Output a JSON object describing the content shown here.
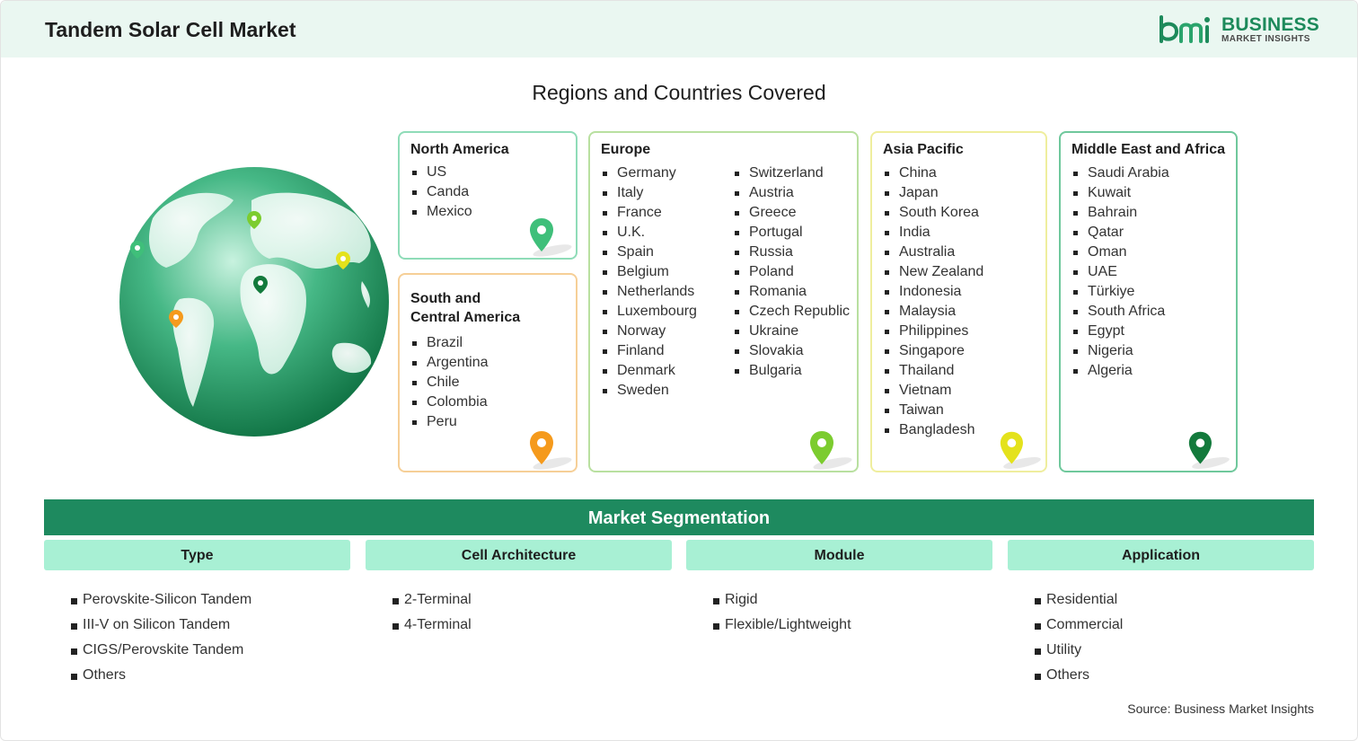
{
  "header": {
    "title": "Tandem Solar Cell Market"
  },
  "logo": {
    "mark": "bmi",
    "word1": "BUSINESS",
    "word2": "MARKET INSIGHTS"
  },
  "regions": {
    "title": "Regions and Countries Covered",
    "north_america": {
      "title": "North America",
      "countries": [
        "US",
        "Canda",
        "Mexico"
      ],
      "pin_color": "#3fbf7a"
    },
    "south_central_america": {
      "title_line1": "South and",
      "title_line2": "Central America",
      "countries": [
        "Brazil",
        "Argentina",
        "Chile",
        "Colombia",
        "Peru"
      ],
      "pin_color": "#f59a1c"
    },
    "europe": {
      "title": "Europe",
      "countries_col1": [
        "Germany",
        "Italy",
        "France",
        "U.K.",
        "Spain",
        "Belgium",
        "Netherlands",
        "Luxembourg",
        "Norway",
        "Finland",
        "Denmark",
        "Sweden"
      ],
      "countries_col2": [
        "Switzerland",
        "Austria",
        "Greece",
        "Portugal",
        "Russia",
        "Poland",
        "Romania",
        "Czech Republic",
        "Ukraine",
        "Slovakia",
        "Bulgaria"
      ],
      "pin_color": "#7ccc2f"
    },
    "asia_pacific": {
      "title": "Asia Pacific",
      "countries": [
        "China",
        "Japan",
        "South Korea",
        "India",
        "Australia",
        "New Zealand",
        "Indonesia",
        "Malaysia",
        "Philippines",
        "Singapore",
        "Thailand",
        "Vietnam",
        "Taiwan",
        "Bangladesh"
      ],
      "pin_color": "#e4e21c"
    },
    "middle_east_africa": {
      "title": "Middle East and Africa",
      "countries": [
        "Saudi Arabia",
        "Kuwait",
        "Bahrain",
        "Qatar",
        "Oman",
        "UAE",
        "Türkiye",
        "South Africa",
        "Egypt",
        "Nigeria",
        "Algeria"
      ],
      "pin_color": "#137a3c"
    }
  },
  "segmentation": {
    "title": "Market Segmentation",
    "columns": [
      {
        "title": "Type",
        "items": [
          "Perovskite-Silicon Tandem",
          "III-V on Silicon Tandem",
          "CIGS/Perovskite Tandem",
          "Others"
        ]
      },
      {
        "title": "Cell Architecture",
        "items": [
          "2-Terminal",
          "4-Terminal"
        ]
      },
      {
        "title": "Module",
        "items": [
          "Rigid",
          "Flexible/Lightweight"
        ]
      },
      {
        "title": "Application",
        "items": [
          "Residential",
          "Commercial",
          "Utility",
          "Others"
        ]
      }
    ]
  },
  "source": "Source: Business Market Insights",
  "colors": {
    "header_bg": "#eaf7f1",
    "accent": "#1e8a5f",
    "segment_head": "#a8f0d4"
  }
}
